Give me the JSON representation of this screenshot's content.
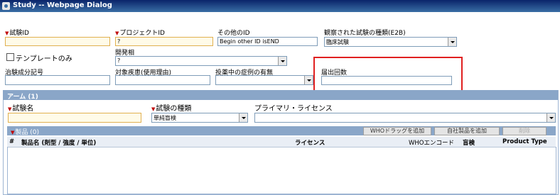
{
  "window": {
    "title": "Study -- Webpage Dialog"
  },
  "fields": {
    "study_id": {
      "label": "試験ID",
      "value": ""
    },
    "project_id": {
      "label": "プロジェクトID",
      "value": "?"
    },
    "other_id": {
      "label": "その他のID",
      "value": "Begin other ID isEND"
    },
    "observed_study_type": {
      "label": "観察された試験の種類(E2B)",
      "value": "臨床試験"
    },
    "template_only": {
      "label": "テンプレートのみ"
    },
    "development_phase": {
      "label": "開発相",
      "value": "?"
    },
    "treatment_code": {
      "label": "治験成分記号",
      "value": ""
    },
    "target_disease": {
      "label": "対象疾患(使用理由)",
      "value": ""
    },
    "pending_cases": {
      "label": "投薬中の症例の有無",
      "value": ""
    },
    "report_count": {
      "label": "届出回数",
      "value": ""
    }
  },
  "arm_section": {
    "title": "アーム (1)",
    "study_name": {
      "label": "試験名",
      "value": ""
    },
    "study_type": {
      "label": "試験の種類",
      "value": "単純盲検"
    },
    "primary_license": {
      "label": "プライマリ・ライセンス",
      "value": ""
    }
  },
  "products": {
    "title": "製品 (0)",
    "buttons": {
      "add_who_drug": "WHOドラッグを追加",
      "add_company_product": "自社製品を追加",
      "delete": "削除"
    },
    "columns": {
      "num": "#",
      "product_name": "製品名 (剤型 / 強度 / 単位)",
      "license": "ライセンス",
      "who_code": "WHOエンコード",
      "blind": "盲検",
      "product_type": "Product Type"
    }
  },
  "colors": {
    "highlight": "#e02020",
    "section_bar": "#8aa6c8",
    "title_bar": "#0a246a"
  }
}
